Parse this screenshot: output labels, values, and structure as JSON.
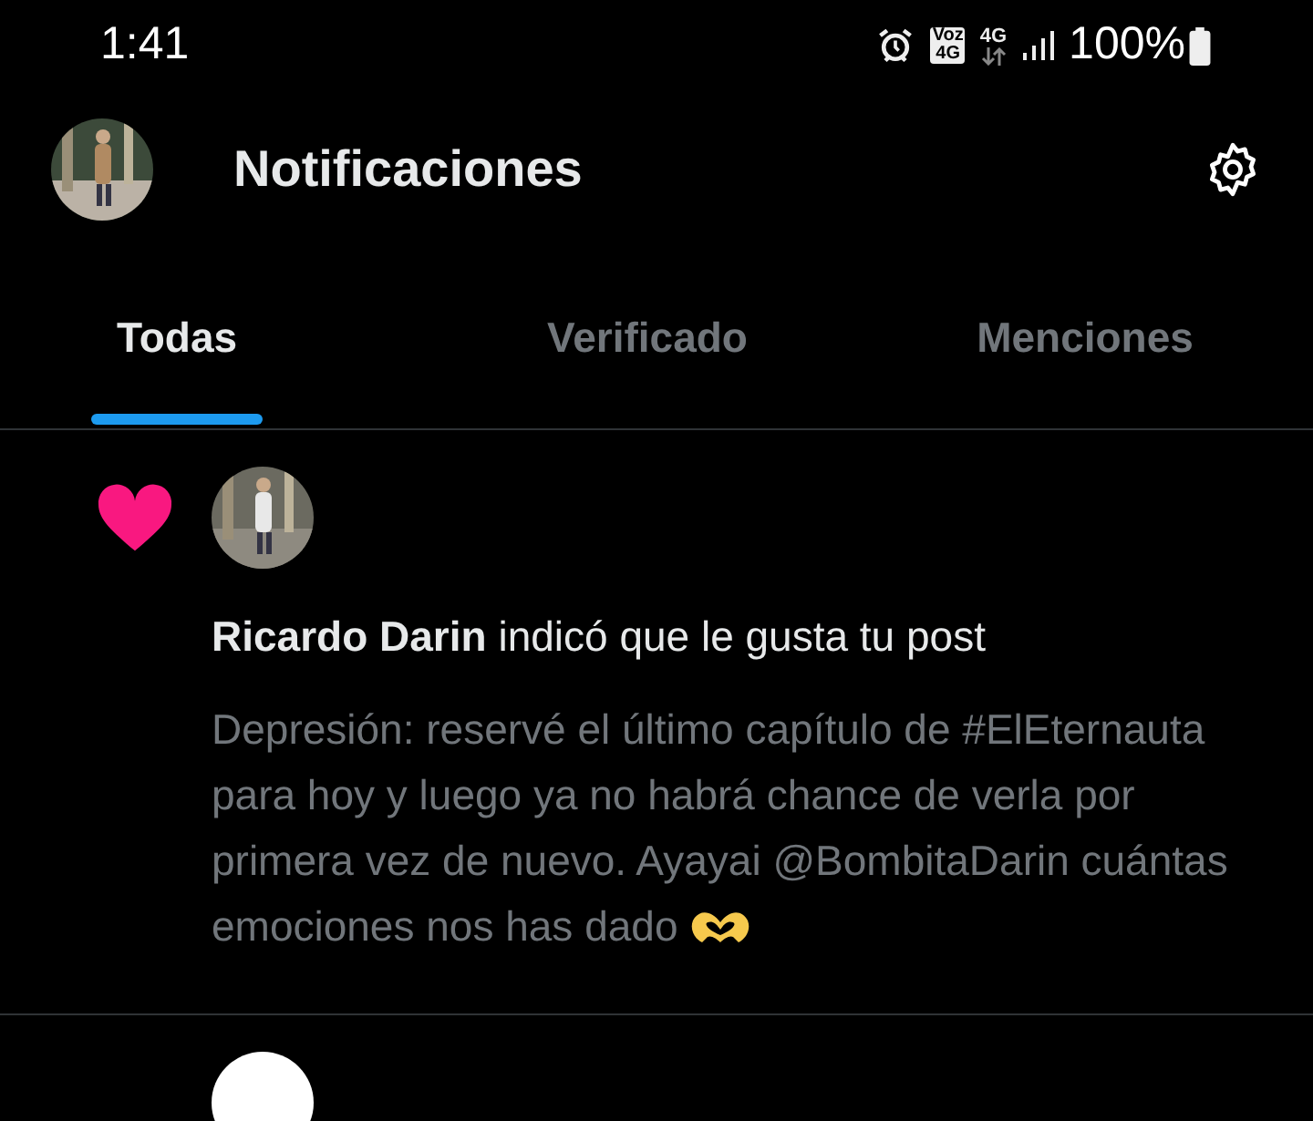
{
  "status_bar": {
    "time": "1:41",
    "volte_badge": [
      "Voz",
      "4G"
    ],
    "network": "4G",
    "battery": "100%"
  },
  "header": {
    "title": "Notificaciones"
  },
  "tabs": [
    {
      "label": "Todas",
      "selected": true
    },
    {
      "label": "Verificado",
      "selected": false
    },
    {
      "label": "Menciones",
      "selected": false
    }
  ],
  "notifications": [
    {
      "kind": "like",
      "user": "Ricardo Darin",
      "action": "indicó que le gusta tu post",
      "text": "Depresión: reservé el último capítulo de #ElEternauta para hoy y luego ya no habrá chance de verla por primera vez de nuevo. Ayayai @BombitaDarin cuántas emociones nos has dado"
    }
  ]
}
